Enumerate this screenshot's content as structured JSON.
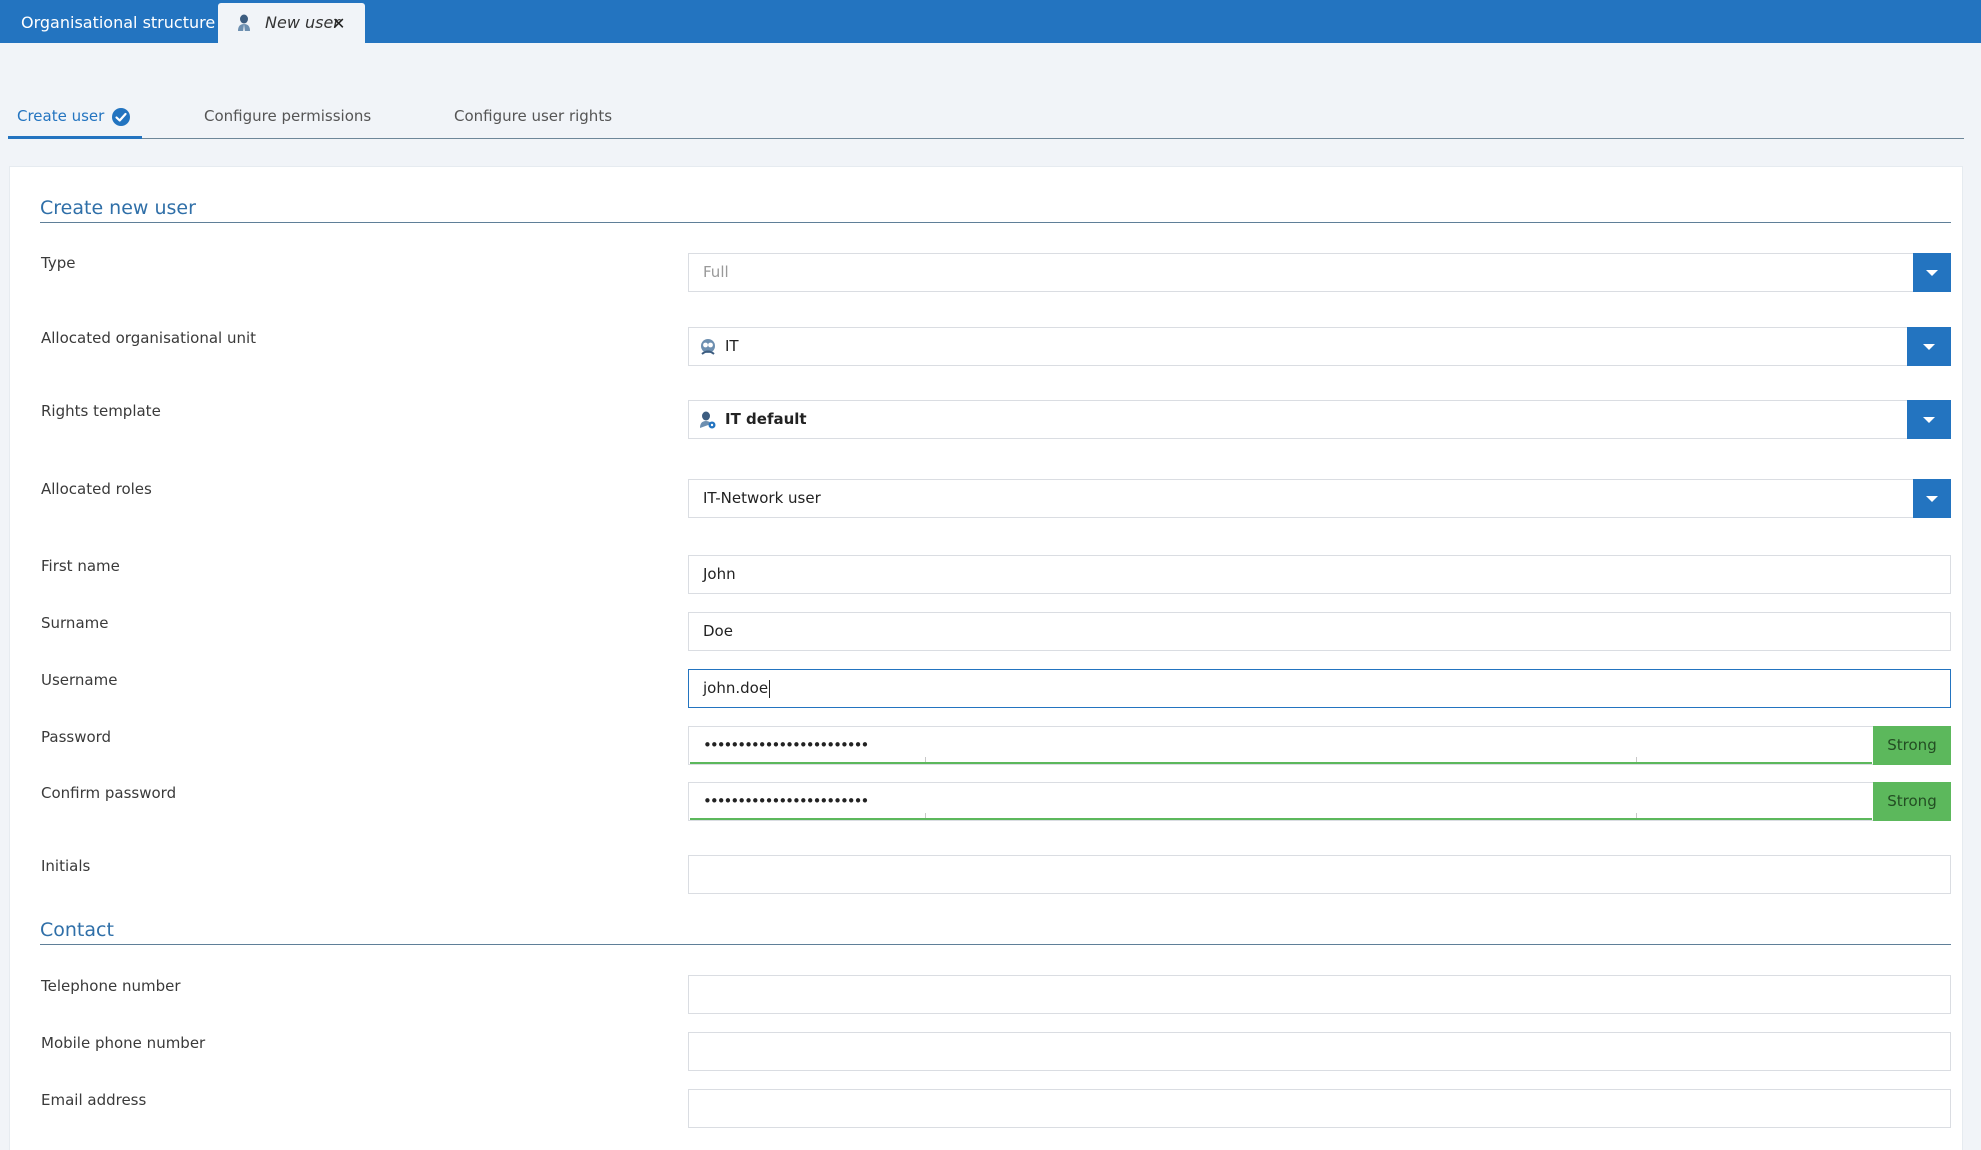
{
  "tabs": {
    "org_structure": "Organisational structure",
    "new_user": "New user",
    "close_glyph": "✕"
  },
  "steps": {
    "create_user": "Create user",
    "configure_permissions": "Configure permissions",
    "configure_user_rights": "Configure user rights"
  },
  "sections": {
    "create_new_user": "Create new user",
    "contact": "Contact"
  },
  "form": {
    "type": {
      "label": "Type",
      "value": "Full"
    },
    "org_unit": {
      "label": "Allocated organisational unit",
      "value": "IT"
    },
    "rights_template": {
      "label": "Rights template",
      "value": "IT default"
    },
    "roles": {
      "label": "Allocated roles",
      "value": "IT-Network user"
    },
    "first_name": {
      "label": "First name",
      "value": "John"
    },
    "surname": {
      "label": "Surname",
      "value": "Doe"
    },
    "username": {
      "label": "Username",
      "value": "john.doe"
    },
    "password": {
      "label": "Password",
      "value": "••••••••••••••••••••••••",
      "strength": "Strong"
    },
    "confirm_password": {
      "label": "Confirm password",
      "value": "••••••••••••••••••••••••",
      "strength": "Strong"
    },
    "initials": {
      "label": "Initials",
      "value": ""
    }
  },
  "contact": {
    "telephone": {
      "label": "Telephone number",
      "value": ""
    },
    "mobile": {
      "label": "Mobile phone number",
      "value": ""
    },
    "email": {
      "label": "Email address",
      "value": ""
    }
  },
  "colors": {
    "accent": "#2374c0",
    "strong": "#5cb85c"
  }
}
